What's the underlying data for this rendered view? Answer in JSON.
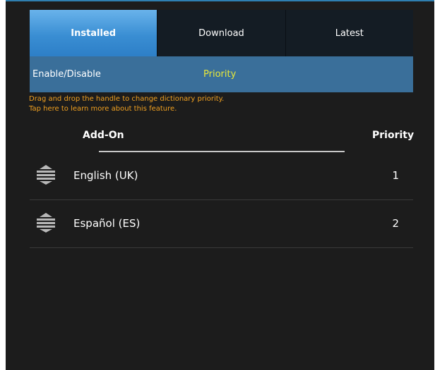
{
  "tabs": [
    {
      "label": "Installed",
      "active": true
    },
    {
      "label": "Download",
      "active": false
    },
    {
      "label": "Latest",
      "active": false
    }
  ],
  "subbar": {
    "enable_label": "Enable/Disable",
    "priority_label": "Priority"
  },
  "hint": {
    "line1": "Drag and drop the handle to change dictionary priority.",
    "line2": "Tap here to learn more about this feature."
  },
  "columns": {
    "addon": "Add-On",
    "priority": "Priority"
  },
  "rows": [
    {
      "name": "English (UK)",
      "priority": "1",
      "icon": "drag-handle-icon"
    },
    {
      "name": "Español (ES)",
      "priority": "2",
      "icon": "drag-handle-icon"
    }
  ],
  "colors": {
    "accent": "#3a8ed3",
    "subbar": "#3a6f9a",
    "priority_highlight": "#e8e83a",
    "hint": "#f0a020",
    "background": "#1c1c1c"
  }
}
